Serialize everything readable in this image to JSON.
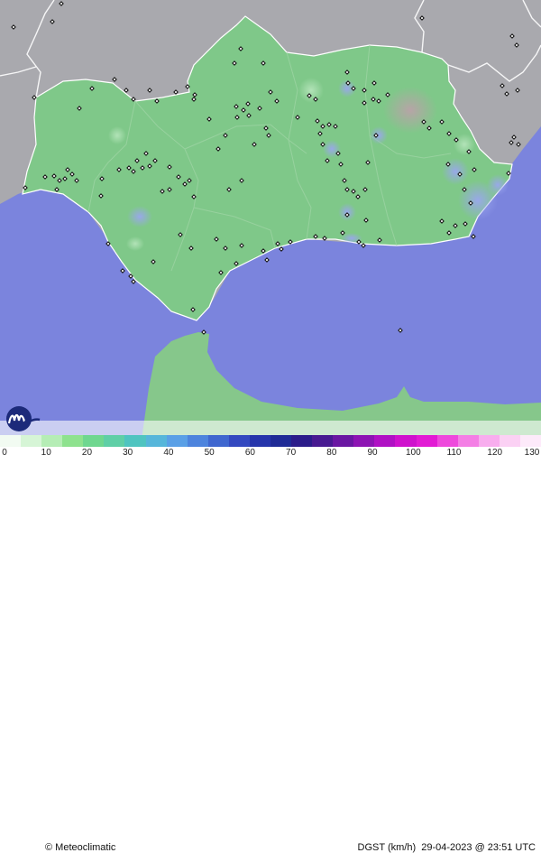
{
  "map": {
    "brand_text": "Meteoclimatic",
    "product_text": "DGST (km/h)",
    "timestamp_text": "29-04-2023 @ 23:51 UTC",
    "colors": {
      "sea": "#7b84dd",
      "outside_land": "#a9a9ae",
      "region_land": "#7fc889",
      "africa_land": "#86c78b",
      "coast_line": "#ffffff"
    }
  },
  "scale": {
    "labels": [
      "0",
      "10",
      "20",
      "30",
      "40",
      "50",
      "60",
      "70",
      "80",
      "90",
      "100",
      "110",
      "120",
      "130"
    ],
    "colors": [
      "#f2fbf2",
      "#d6f5d6",
      "#b5edb5",
      "#8ee28e",
      "#6fd78f",
      "#5fcfa6",
      "#4fc4c0",
      "#56b6da",
      "#5aa0e6",
      "#4d84dd",
      "#3f67cf",
      "#3349c0",
      "#2635ab",
      "#1f2b96",
      "#2b1c8a",
      "#481a91",
      "#6a17a2",
      "#8d14b3",
      "#b011c4",
      "#cf12cd",
      "#e21bd4",
      "#ee49dc",
      "#f47fe5",
      "#f8adee",
      "#fbd1f4",
      "#fdeafa"
    ]
  }
}
